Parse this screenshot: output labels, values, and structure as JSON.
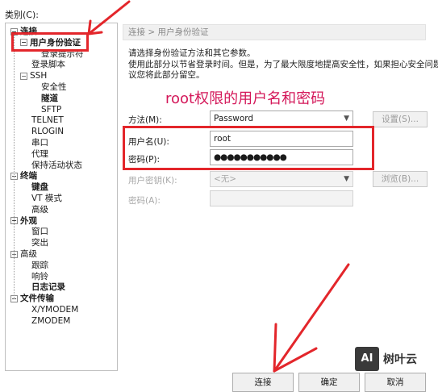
{
  "category_label": "类别(C):",
  "tree": {
    "items": [
      {
        "label": "连接",
        "level": 0,
        "toggle": "⊟",
        "bold": true
      },
      {
        "label": "用户身份验证",
        "level": 1,
        "toggle": "⊟",
        "bold": true,
        "selected": true
      },
      {
        "label": "登录提示符",
        "level": 2,
        "toggle": "",
        "bold": false
      },
      {
        "label": "登录脚本",
        "level": 1,
        "toggle": "",
        "bold": false
      },
      {
        "label": "SSH",
        "level": 1,
        "toggle": "⊟",
        "bold": false
      },
      {
        "label": "安全性",
        "level": 2,
        "toggle": "",
        "bold": false
      },
      {
        "label": "隧道",
        "level": 2,
        "toggle": "",
        "bold": true
      },
      {
        "label": "SFTP",
        "level": 2,
        "toggle": "",
        "bold": false
      },
      {
        "label": "TELNET",
        "level": 1,
        "toggle": "",
        "bold": false
      },
      {
        "label": "RLOGIN",
        "level": 1,
        "toggle": "",
        "bold": false
      },
      {
        "label": "串口",
        "level": 1,
        "toggle": "",
        "bold": false
      },
      {
        "label": "代理",
        "level": 1,
        "toggle": "",
        "bold": false
      },
      {
        "label": "保持活动状态",
        "level": 1,
        "toggle": "",
        "bold": false
      },
      {
        "label": "终端",
        "level": 0,
        "toggle": "⊟",
        "bold": true
      },
      {
        "label": "键盘",
        "level": 1,
        "toggle": "",
        "bold": true
      },
      {
        "label": "VT 模式",
        "level": 1,
        "toggle": "",
        "bold": false
      },
      {
        "label": "高级",
        "level": 1,
        "toggle": "",
        "bold": false
      },
      {
        "label": "外观",
        "level": 0,
        "toggle": "⊟",
        "bold": true
      },
      {
        "label": "窗口",
        "level": 1,
        "toggle": "",
        "bold": false
      },
      {
        "label": "突出",
        "level": 1,
        "toggle": "",
        "bold": false
      },
      {
        "label": "高级",
        "level": 0,
        "toggle": "⊟",
        "bold": false
      },
      {
        "label": "跟踪",
        "level": 1,
        "toggle": "",
        "bold": false
      },
      {
        "label": "响铃",
        "level": 1,
        "toggle": "",
        "bold": false
      },
      {
        "label": "日志记录",
        "level": 1,
        "toggle": "",
        "bold": true
      },
      {
        "label": "文件传输",
        "level": 0,
        "toggle": "⊟",
        "bold": true
      },
      {
        "label": "X/YMODEM",
        "level": 1,
        "toggle": "",
        "bold": false
      },
      {
        "label": "ZMODEM",
        "level": 1,
        "toggle": "",
        "bold": false
      }
    ]
  },
  "breadcrumb": "连接 > 用户身份验证",
  "description": {
    "line1": "请选择身份验证方法和其它参数。",
    "line2": "使用此部分以节省登录时间。但是，为了最大限度地提高安全性，如果担心安全问题，建",
    "line3": "议您将此部分留空。"
  },
  "annotation": "root权限的用户名和密码",
  "form": {
    "method_label": "方法(M):",
    "method_value": "Password",
    "settings_button": "设置(S)...",
    "username_label": "用户名(U):",
    "username_value": "root",
    "password_label": "密码(P):",
    "password_value": "●●●●●●●●●●●",
    "user_key_label": "用户密钥(K):",
    "user_key_value": "<无>",
    "browse_button": "浏览(B)...",
    "passphrase_label": "密码(A):",
    "passphrase_value": ""
  },
  "buttons": {
    "connect": "连接",
    "ok": "确定",
    "cancel": "取消"
  },
  "watermark": {
    "logo": "AI",
    "text": "树叶云"
  },
  "colors": {
    "highlight_red": "#e3262b",
    "annotation_pink": "#d4185a"
  }
}
